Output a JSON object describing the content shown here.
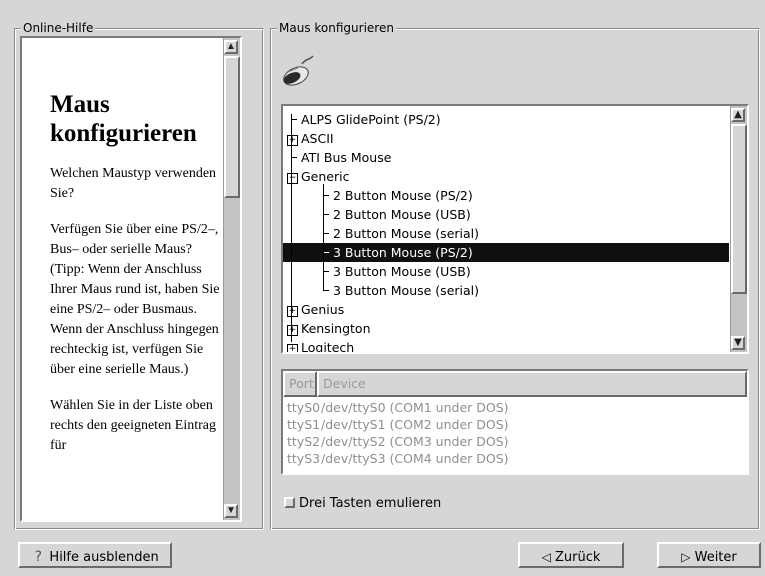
{
  "help": {
    "legend": "Online-Hilfe",
    "title": "Maus konfigurieren",
    "paragraphs": [
      "Welchen Maustyp verwenden Sie?",
      "Verfügen Sie über eine PS/2–, Bus– oder serielle Maus? (Tipp: Wenn der Anschluss Ihrer Maus rund ist, haben Sie eine PS/2– oder Busmaus. Wenn der Anschluss hingegen rechteckig ist, verfügen Sie über eine serielle Maus.)",
      "Wählen Sie in der Liste oben rechts den geeigneten Eintrag für"
    ]
  },
  "config": {
    "legend": "Maus konfigurieren",
    "icon": "mouse-icon",
    "tree": [
      {
        "label": "ALPS GlidePoint (PS/2)",
        "level": 0,
        "expander": ""
      },
      {
        "label": "ASCII",
        "level": 0,
        "expander": "+"
      },
      {
        "label": "ATI Bus Mouse",
        "level": 0,
        "expander": ""
      },
      {
        "label": "Generic",
        "level": 0,
        "expander": "−"
      },
      {
        "label": "2 Button Mouse (PS/2)",
        "level": 1,
        "expander": ""
      },
      {
        "label": "2 Button Mouse (USB)",
        "level": 1,
        "expander": ""
      },
      {
        "label": "2 Button Mouse (serial)",
        "level": 1,
        "expander": ""
      },
      {
        "label": "3 Button Mouse (PS/2)",
        "level": 1,
        "expander": "",
        "selected": true
      },
      {
        "label": "3 Button Mouse (USB)",
        "level": 1,
        "expander": ""
      },
      {
        "label": "3 Button Mouse (serial)",
        "level": 1,
        "expander": ""
      },
      {
        "label": "Genius",
        "level": 0,
        "expander": "+"
      },
      {
        "label": "Kensington",
        "level": 0,
        "expander": "+"
      },
      {
        "label": "Logitech",
        "level": 0,
        "expander": "+"
      }
    ],
    "ports_columns": [
      "Port",
      "Device"
    ],
    "ports": [
      {
        "port": "ttyS0",
        "device": "/dev/ttyS0 (COM1 under DOS)"
      },
      {
        "port": "ttyS1",
        "device": "/dev/ttyS1 (COM2 under DOS)"
      },
      {
        "port": "ttyS2",
        "device": "/dev/ttyS2 (COM3 under DOS)"
      },
      {
        "port": "ttyS3",
        "device": "/dev/ttyS3 (COM4 under DOS)"
      }
    ],
    "emulate_label": "Drei Tasten emulieren",
    "emulate_checked": false
  },
  "buttons": {
    "hide_help": "Hilfe ausblenden",
    "back": "Zurück",
    "next": "Weiter"
  }
}
